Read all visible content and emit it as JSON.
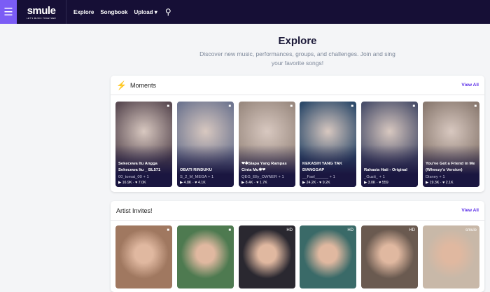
{
  "header": {
    "brand": "smule",
    "tagline": "LET'S MUSIC TOGETHER",
    "nav": [
      "Explore",
      "Songbook",
      "Upload"
    ]
  },
  "page": {
    "title": "Explore",
    "subtitle": "Discover new music, performances, groups, and challenges. Join and sing your favorite songs!"
  },
  "moments": {
    "title": "Moments",
    "view_all": "View All",
    "cards": [
      {
        "title": "Sekecewa Itu Angga Sekecewa Itu _ BL571",
        "user": "00_tomat_00 + 1",
        "plays": "16.9K",
        "likes": "7.0K",
        "color": "#5a4a52"
      },
      {
        "title": "OBATI RINDUKU",
        "user": "S_2_M_MEGA + 1",
        "plays": "4.8K",
        "likes": "4.1K",
        "color": "#6f7690"
      },
      {
        "title": "❤✱Siapa Yang Rampas Cinta Mu✱❤",
        "user": "QEG_Elly_OWNER + 1",
        "plays": "8.4K",
        "likes": "1.7K",
        "color": "#9a8a80"
      },
      {
        "title": "KEKASIH YANG TAK DIANGGAP",
        "user": "__Fael______ + 1",
        "plays": "24.2K",
        "likes": "9.2K",
        "color": "#2d4a6a"
      },
      {
        "title": "Rahasia Hati - Original",
        "user": "_Guzti_ + 1",
        "plays": "3.0K",
        "likes": "559",
        "color": "#4a4f6a"
      },
      {
        "title": "You've Got a Friend in Me (Wheezy's Version)",
        "user": "Disney + 1",
        "plays": "19.3K",
        "likes": "2.1K",
        "color": "#8a7a70"
      }
    ]
  },
  "artist_invites": {
    "title": "Artist Invites!",
    "view_all": "View All",
    "cards": [
      {
        "color": "#a07860"
      },
      {
        "color": "#4e7a50"
      },
      {
        "color": "#2a2830",
        "badge": "HD"
      },
      {
        "color": "#3a6a68",
        "badge": "HD"
      },
      {
        "color": "#6a5a50",
        "badge": "HD"
      },
      {
        "color": "#c8b8a8",
        "badge": "smule"
      }
    ]
  }
}
